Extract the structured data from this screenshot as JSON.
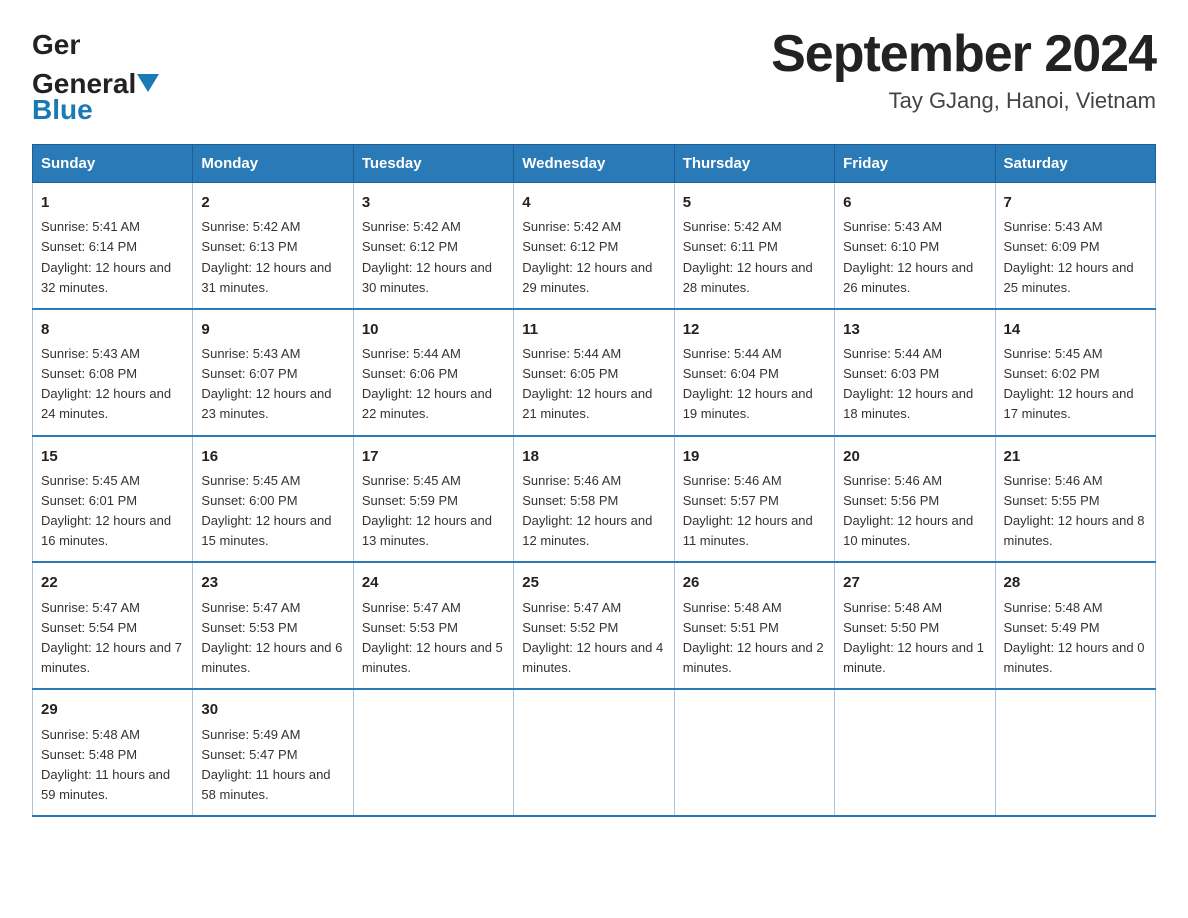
{
  "header": {
    "logo_general": "General",
    "logo_blue": "Blue",
    "month_title": "September 2024",
    "location": "Tay GJang, Hanoi, Vietnam"
  },
  "days_of_week": [
    "Sunday",
    "Monday",
    "Tuesday",
    "Wednesday",
    "Thursday",
    "Friday",
    "Saturday"
  ],
  "weeks": [
    [
      {
        "day": "1",
        "sunrise": "Sunrise: 5:41 AM",
        "sunset": "Sunset: 6:14 PM",
        "daylight": "Daylight: 12 hours and 32 minutes."
      },
      {
        "day": "2",
        "sunrise": "Sunrise: 5:42 AM",
        "sunset": "Sunset: 6:13 PM",
        "daylight": "Daylight: 12 hours and 31 minutes."
      },
      {
        "day": "3",
        "sunrise": "Sunrise: 5:42 AM",
        "sunset": "Sunset: 6:12 PM",
        "daylight": "Daylight: 12 hours and 30 minutes."
      },
      {
        "day": "4",
        "sunrise": "Sunrise: 5:42 AM",
        "sunset": "Sunset: 6:12 PM",
        "daylight": "Daylight: 12 hours and 29 minutes."
      },
      {
        "day": "5",
        "sunrise": "Sunrise: 5:42 AM",
        "sunset": "Sunset: 6:11 PM",
        "daylight": "Daylight: 12 hours and 28 minutes."
      },
      {
        "day": "6",
        "sunrise": "Sunrise: 5:43 AM",
        "sunset": "Sunset: 6:10 PM",
        "daylight": "Daylight: 12 hours and 26 minutes."
      },
      {
        "day": "7",
        "sunrise": "Sunrise: 5:43 AM",
        "sunset": "Sunset: 6:09 PM",
        "daylight": "Daylight: 12 hours and 25 minutes."
      }
    ],
    [
      {
        "day": "8",
        "sunrise": "Sunrise: 5:43 AM",
        "sunset": "Sunset: 6:08 PM",
        "daylight": "Daylight: 12 hours and 24 minutes."
      },
      {
        "day": "9",
        "sunrise": "Sunrise: 5:43 AM",
        "sunset": "Sunset: 6:07 PM",
        "daylight": "Daylight: 12 hours and 23 minutes."
      },
      {
        "day": "10",
        "sunrise": "Sunrise: 5:44 AM",
        "sunset": "Sunset: 6:06 PM",
        "daylight": "Daylight: 12 hours and 22 minutes."
      },
      {
        "day": "11",
        "sunrise": "Sunrise: 5:44 AM",
        "sunset": "Sunset: 6:05 PM",
        "daylight": "Daylight: 12 hours and 21 minutes."
      },
      {
        "day": "12",
        "sunrise": "Sunrise: 5:44 AM",
        "sunset": "Sunset: 6:04 PM",
        "daylight": "Daylight: 12 hours and 19 minutes."
      },
      {
        "day": "13",
        "sunrise": "Sunrise: 5:44 AM",
        "sunset": "Sunset: 6:03 PM",
        "daylight": "Daylight: 12 hours and 18 minutes."
      },
      {
        "day": "14",
        "sunrise": "Sunrise: 5:45 AM",
        "sunset": "Sunset: 6:02 PM",
        "daylight": "Daylight: 12 hours and 17 minutes."
      }
    ],
    [
      {
        "day": "15",
        "sunrise": "Sunrise: 5:45 AM",
        "sunset": "Sunset: 6:01 PM",
        "daylight": "Daylight: 12 hours and 16 minutes."
      },
      {
        "day": "16",
        "sunrise": "Sunrise: 5:45 AM",
        "sunset": "Sunset: 6:00 PM",
        "daylight": "Daylight: 12 hours and 15 minutes."
      },
      {
        "day": "17",
        "sunrise": "Sunrise: 5:45 AM",
        "sunset": "Sunset: 5:59 PM",
        "daylight": "Daylight: 12 hours and 13 minutes."
      },
      {
        "day": "18",
        "sunrise": "Sunrise: 5:46 AM",
        "sunset": "Sunset: 5:58 PM",
        "daylight": "Daylight: 12 hours and 12 minutes."
      },
      {
        "day": "19",
        "sunrise": "Sunrise: 5:46 AM",
        "sunset": "Sunset: 5:57 PM",
        "daylight": "Daylight: 12 hours and 11 minutes."
      },
      {
        "day": "20",
        "sunrise": "Sunrise: 5:46 AM",
        "sunset": "Sunset: 5:56 PM",
        "daylight": "Daylight: 12 hours and 10 minutes."
      },
      {
        "day": "21",
        "sunrise": "Sunrise: 5:46 AM",
        "sunset": "Sunset: 5:55 PM",
        "daylight": "Daylight: 12 hours and 8 minutes."
      }
    ],
    [
      {
        "day": "22",
        "sunrise": "Sunrise: 5:47 AM",
        "sunset": "Sunset: 5:54 PM",
        "daylight": "Daylight: 12 hours and 7 minutes."
      },
      {
        "day": "23",
        "sunrise": "Sunrise: 5:47 AM",
        "sunset": "Sunset: 5:53 PM",
        "daylight": "Daylight: 12 hours and 6 minutes."
      },
      {
        "day": "24",
        "sunrise": "Sunrise: 5:47 AM",
        "sunset": "Sunset: 5:53 PM",
        "daylight": "Daylight: 12 hours and 5 minutes."
      },
      {
        "day": "25",
        "sunrise": "Sunrise: 5:47 AM",
        "sunset": "Sunset: 5:52 PM",
        "daylight": "Daylight: 12 hours and 4 minutes."
      },
      {
        "day": "26",
        "sunrise": "Sunrise: 5:48 AM",
        "sunset": "Sunset: 5:51 PM",
        "daylight": "Daylight: 12 hours and 2 minutes."
      },
      {
        "day": "27",
        "sunrise": "Sunrise: 5:48 AM",
        "sunset": "Sunset: 5:50 PM",
        "daylight": "Daylight: 12 hours and 1 minute."
      },
      {
        "day": "28",
        "sunrise": "Sunrise: 5:48 AM",
        "sunset": "Sunset: 5:49 PM",
        "daylight": "Daylight: 12 hours and 0 minutes."
      }
    ],
    [
      {
        "day": "29",
        "sunrise": "Sunrise: 5:48 AM",
        "sunset": "Sunset: 5:48 PM",
        "daylight": "Daylight: 11 hours and 59 minutes."
      },
      {
        "day": "30",
        "sunrise": "Sunrise: 5:49 AM",
        "sunset": "Sunset: 5:47 PM",
        "daylight": "Daylight: 11 hours and 58 minutes."
      },
      {
        "day": "",
        "sunrise": "",
        "sunset": "",
        "daylight": ""
      },
      {
        "day": "",
        "sunrise": "",
        "sunset": "",
        "daylight": ""
      },
      {
        "day": "",
        "sunrise": "",
        "sunset": "",
        "daylight": ""
      },
      {
        "day": "",
        "sunrise": "",
        "sunset": "",
        "daylight": ""
      },
      {
        "day": "",
        "sunrise": "",
        "sunset": "",
        "daylight": ""
      }
    ]
  ]
}
